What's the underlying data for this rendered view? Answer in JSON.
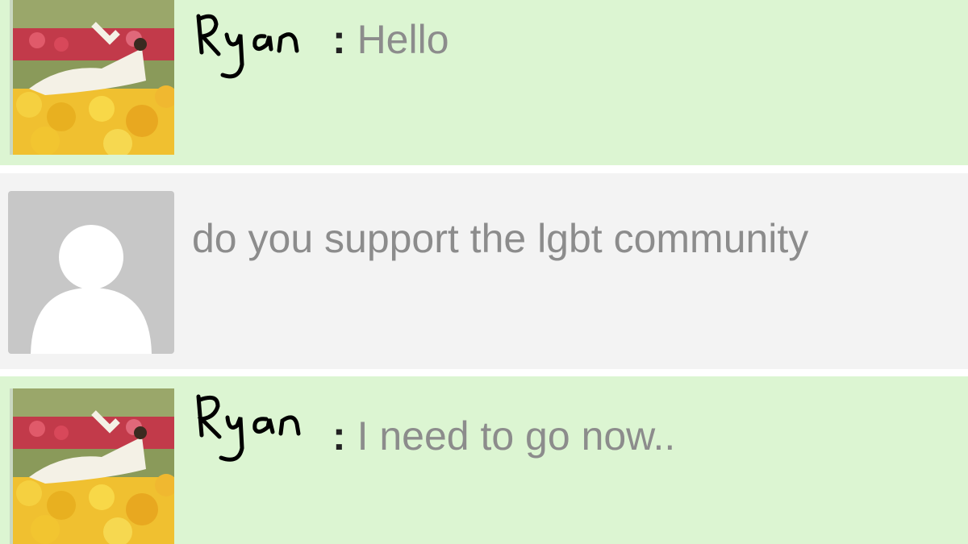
{
  "messages": [
    {
      "sender": "Ryan",
      "text": "Hello",
      "avatar": "photo-person-in-flowers"
    },
    {
      "sender": "",
      "text": "do you support the lgbt community",
      "avatar": "default-user-silhouette"
    },
    {
      "sender": "Ryan",
      "text": "I need to go now..",
      "avatar": "photo-person-in-flowers"
    }
  ],
  "separator": ":",
  "colors": {
    "green_row": "#dcf5d2",
    "grey_row": "#f3f3f3",
    "message_text": "#8c8c8c",
    "handwriting": "#000000"
  }
}
